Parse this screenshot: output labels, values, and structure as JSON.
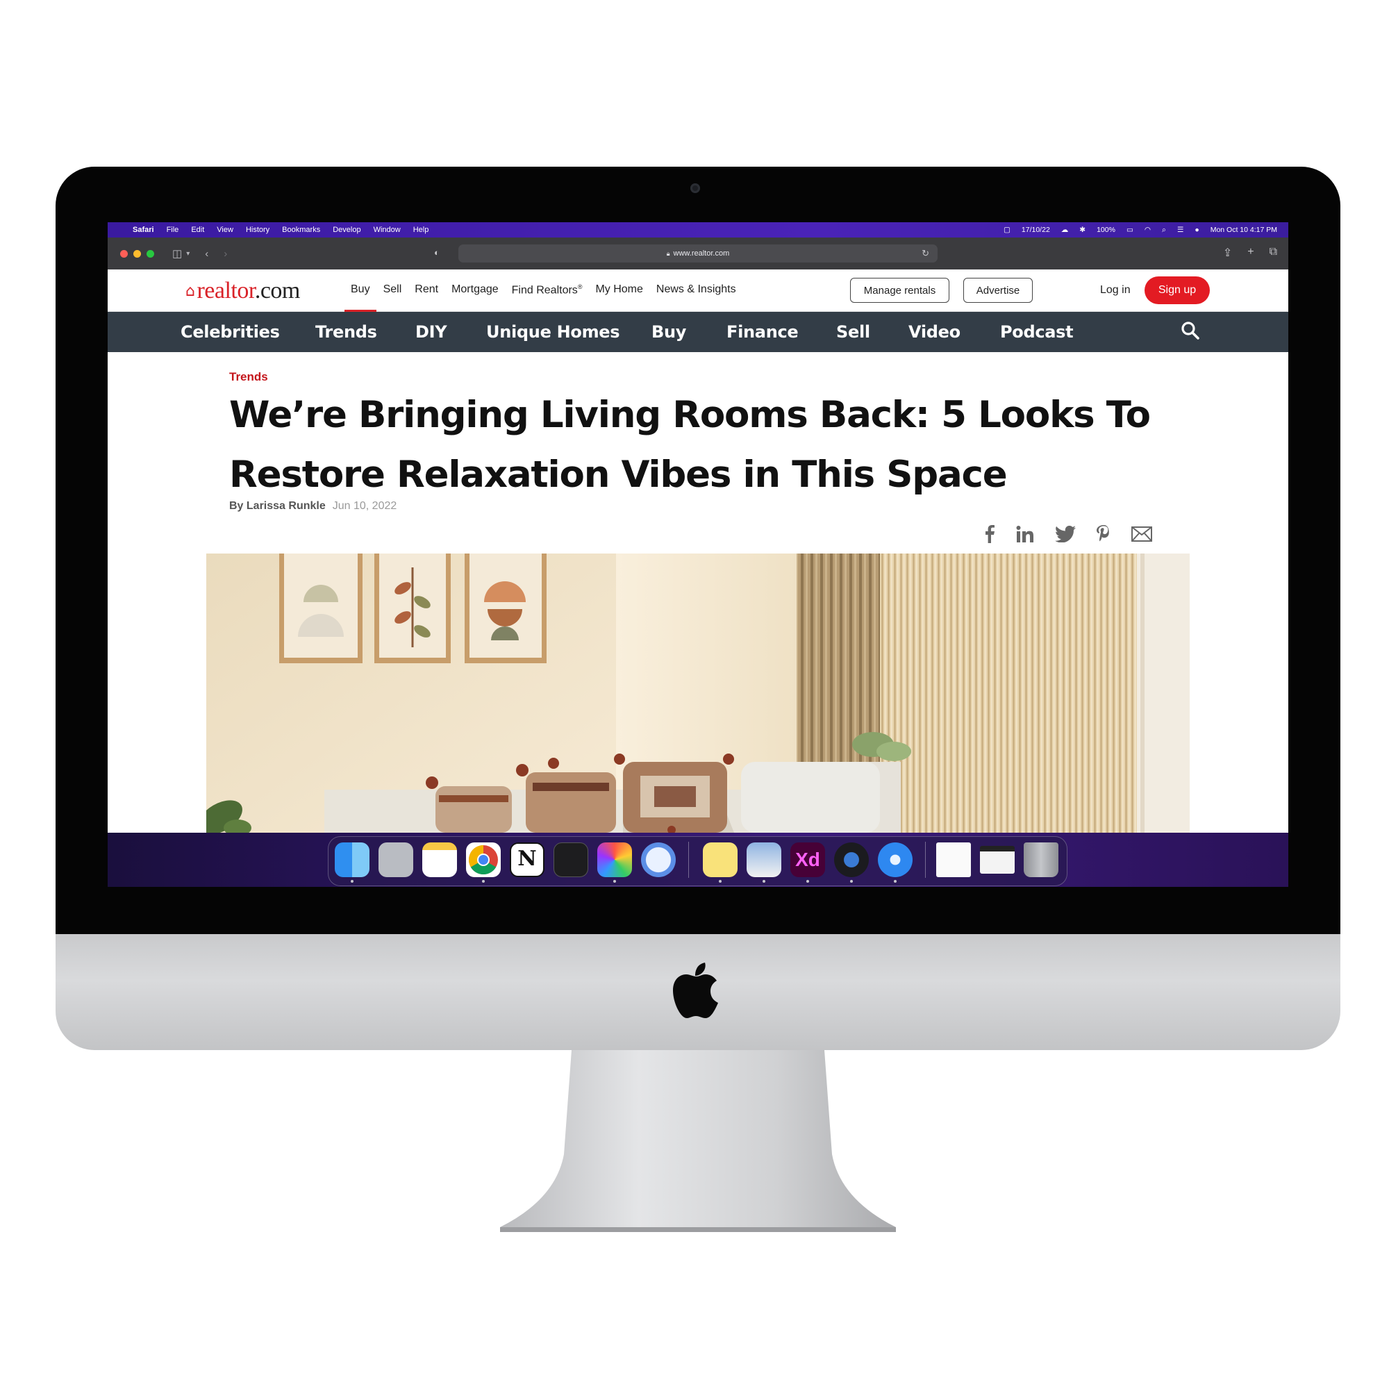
{
  "menubar": {
    "app": "Safari",
    "menus": [
      "File",
      "Edit",
      "View",
      "History",
      "Bookmarks",
      "Develop",
      "Window",
      "Help"
    ],
    "date_short": "17/10/22",
    "battery": "100%",
    "clock": "Mon Oct 10  4:17 PM"
  },
  "browser": {
    "url": "www.realtor.com"
  },
  "site": {
    "logo_brand": "realtor",
    "logo_tld": ".com",
    "topnav": [
      "Buy",
      "Sell",
      "Rent",
      "Mortgage",
      "Find Realtors",
      "My Home",
      "News & Insights"
    ],
    "find_realtors_mark": "®",
    "manage_rentals": "Manage rentals",
    "advertise": "Advertise",
    "login": "Log in",
    "signup": "Sign up",
    "categories": [
      "Celebrities",
      "Trends",
      "DIY",
      "Unique Homes",
      "Buy",
      "Finance",
      "Sell",
      "Video",
      "Podcast"
    ]
  },
  "article": {
    "kicker": "Trends",
    "headline_line1": "We’re Bringing Living Rooms Back: 5 Looks To",
    "headline_line2": "Restore Relaxation Vibes in This Space",
    "author": "By Larissa Runkle",
    "date": "Jun 10, 2022",
    "share_icons": [
      "facebook-icon",
      "linkedin-icon",
      "twitter-icon",
      "pinterest-icon",
      "email-icon"
    ]
  },
  "dock": {
    "apps": [
      "finder-icon",
      "launchpad-icon",
      "notes-icon",
      "chrome-icon",
      "notion-icon",
      "terminal-icon",
      "screen-app-icon",
      "lock-app-icon",
      "stickies-icon",
      "preview-icon",
      "adobe-xd-icon",
      "quicktime-icon",
      "safari-icon",
      "document-icon",
      "window-preview-icon",
      "trash-icon"
    ],
    "xd_label": "Xd",
    "notion_label": "N"
  },
  "colors": {
    "brand_red": "#d92228",
    "signup_red": "#e31b23",
    "catnav_bg": "#333d47",
    "menubar_purple": "#4a23b8"
  }
}
